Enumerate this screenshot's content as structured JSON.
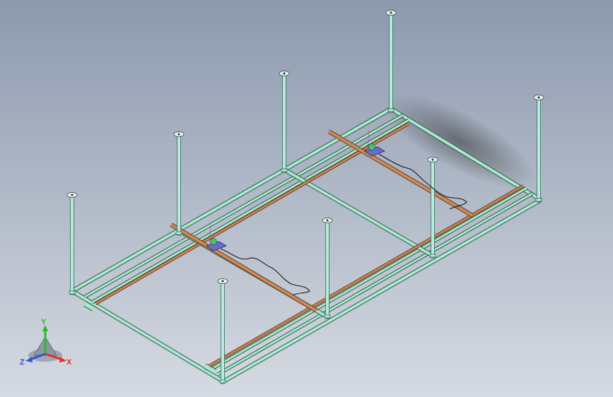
{
  "colors": {
    "background_top": "#8C99AE",
    "background_bottom": "#D6DAE2",
    "frame_fill": "#A9E6D3",
    "frame_edge": "#2F5A3C",
    "rail_fill": "#C98A5C",
    "rail_edge": "#6B3A1E",
    "column_fill": "#B9E8DC",
    "column_edge": "#2E6A5A",
    "trolley_body": "#6E6AC8",
    "motor": "#49C27A",
    "cable": "#1A1A1A",
    "axis_x": "#E0302A",
    "axis_y": "#2EB82E",
    "axis_z": "#2D56D6"
  },
  "icons": {
    "view_triad": "view-orientation-triad-icon"
  },
  "triad": {
    "x_label": "X",
    "y_label": "Y",
    "z_label": "Z"
  }
}
